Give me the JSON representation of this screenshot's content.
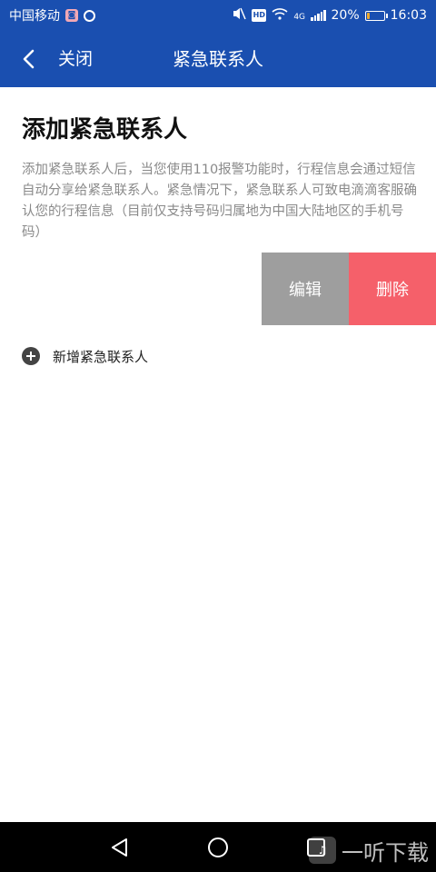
{
  "status_bar": {
    "carrier": "中国移动",
    "network_type": "4G",
    "battery": "20%",
    "battery_level": 0.2,
    "time": "16:03",
    "icons": [
      "carrier-app-icon",
      "sync-icon",
      "mute-icon",
      "hd-icon",
      "wifi-icon",
      "signal-icon",
      "battery-icon"
    ]
  },
  "app_bar": {
    "close_label": "关闭",
    "title": "紧急联系人",
    "background_color": "#1a4fb0"
  },
  "main": {
    "heading": "添加紧急联系人",
    "description": "添加紧急联系人后，当您使用110报警功能时，行程信息会通过短信自动分享给紧急联系人。紧急情况下，紧急联系人可致电滴滴客服确认您的行程信息（目前仅支持号码归属地为中国大陆地区的手机号码）",
    "swipe_actions": {
      "edit_label": "编辑",
      "delete_label": "删除",
      "edit_color": "#9e9e9e",
      "delete_color": "#f5606a"
    },
    "add_contact_label": "新增紧急联系人"
  },
  "nav_bar": {
    "icons": [
      "back-triangle-icon",
      "home-circle-icon",
      "recent-square-icon"
    ]
  },
  "watermark": {
    "text": "一听下载"
  }
}
